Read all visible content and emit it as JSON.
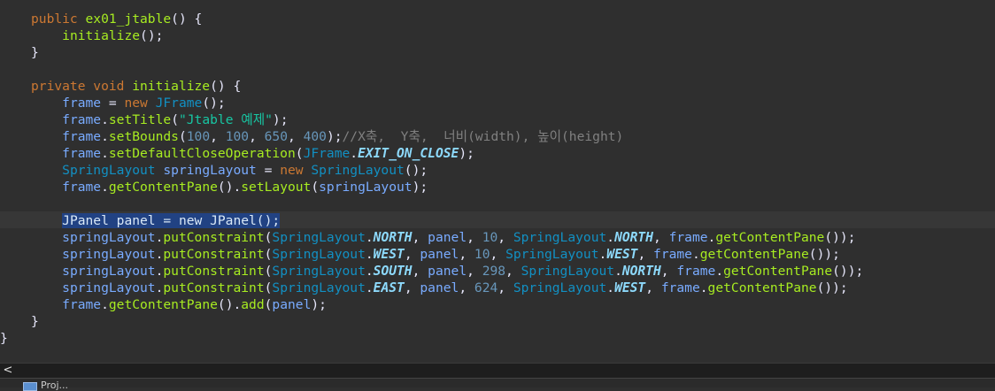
{
  "editor": {
    "lines": [
      [
        [
          "kw",
          "public "
        ],
        [
          "fn",
          "ex01_jtable"
        ],
        [
          "plain",
          "() {"
        ]
      ],
      [
        [
          "plain",
          "    "
        ],
        [
          "fn",
          "initialize"
        ],
        [
          "plain",
          "();"
        ]
      ],
      [
        [
          "plain",
          "}"
        ]
      ],
      [],
      [
        [
          "kw",
          "private void "
        ],
        [
          "fn",
          "initialize"
        ],
        [
          "plain",
          "() {"
        ]
      ],
      [
        [
          "plain",
          "    "
        ],
        [
          "var",
          "frame"
        ],
        [
          "plain",
          " = "
        ],
        [
          "kw",
          "new "
        ],
        [
          "cls",
          "JFrame"
        ],
        [
          "plain",
          "();"
        ]
      ],
      [
        [
          "plain",
          "    "
        ],
        [
          "var",
          "frame"
        ],
        [
          "plain",
          "."
        ],
        [
          "fn",
          "setTitle"
        ],
        [
          "plain",
          "("
        ],
        [
          "str",
          "\"Jtable 예제\""
        ],
        [
          "plain",
          ");"
        ]
      ],
      [
        [
          "plain",
          "    "
        ],
        [
          "var",
          "frame"
        ],
        [
          "plain",
          "."
        ],
        [
          "fn",
          "setBounds"
        ],
        [
          "plain",
          "("
        ],
        [
          "num",
          "100"
        ],
        [
          "plain",
          ", "
        ],
        [
          "num",
          "100"
        ],
        [
          "plain",
          ", "
        ],
        [
          "num",
          "650"
        ],
        [
          "plain",
          ", "
        ],
        [
          "num",
          "400"
        ],
        [
          "plain",
          ");"
        ],
        [
          "cmt",
          "//X축,  Y축,  너비(width), 높이(height)"
        ]
      ],
      [
        [
          "plain",
          "    "
        ],
        [
          "var",
          "frame"
        ],
        [
          "plain",
          "."
        ],
        [
          "fn",
          "setDefaultCloseOperation"
        ],
        [
          "plain",
          "("
        ],
        [
          "cls",
          "JFrame"
        ],
        [
          "plain",
          "."
        ],
        [
          "cst",
          "EXIT_ON_CLOSE"
        ],
        [
          "plain",
          ");"
        ]
      ],
      [
        [
          "plain",
          "    "
        ],
        [
          "cls",
          "SpringLayout "
        ],
        [
          "var",
          "springLayout"
        ],
        [
          "plain",
          " = "
        ],
        [
          "kw",
          "new "
        ],
        [
          "cls",
          "SpringLayout"
        ],
        [
          "plain",
          "();"
        ]
      ],
      [
        [
          "plain",
          "    "
        ],
        [
          "var",
          "frame"
        ],
        [
          "plain",
          "."
        ],
        [
          "fn",
          "getContentPane"
        ],
        [
          "plain",
          "()."
        ],
        [
          "fn",
          "setLayout"
        ],
        [
          "plain",
          "("
        ],
        [
          "var",
          "springLayout"
        ],
        [
          "plain",
          ");"
        ]
      ],
      [],
      [
        [
          "plain",
          "    "
        ],
        [
          "sel",
          "JPanel panel = new JPanel();"
        ]
      ],
      [
        [
          "plain",
          "    "
        ],
        [
          "var",
          "springLayout"
        ],
        [
          "plain",
          "."
        ],
        [
          "fn",
          "putConstraint"
        ],
        [
          "plain",
          "("
        ],
        [
          "cls",
          "SpringLayout"
        ],
        [
          "plain",
          "."
        ],
        [
          "cst",
          "NORTH"
        ],
        [
          "plain",
          ", "
        ],
        [
          "var",
          "panel"
        ],
        [
          "plain",
          ", "
        ],
        [
          "num",
          "10"
        ],
        [
          "plain",
          ", "
        ],
        [
          "cls",
          "SpringLayout"
        ],
        [
          "plain",
          "."
        ],
        [
          "cst",
          "NORTH"
        ],
        [
          "plain",
          ", "
        ],
        [
          "var",
          "frame"
        ],
        [
          "plain",
          "."
        ],
        [
          "fn",
          "getContentPane"
        ],
        [
          "plain",
          "());"
        ]
      ],
      [
        [
          "plain",
          "    "
        ],
        [
          "var",
          "springLayout"
        ],
        [
          "plain",
          "."
        ],
        [
          "fn",
          "putConstraint"
        ],
        [
          "plain",
          "("
        ],
        [
          "cls",
          "SpringLayout"
        ],
        [
          "plain",
          "."
        ],
        [
          "cst",
          "WEST"
        ],
        [
          "plain",
          ", "
        ],
        [
          "var",
          "panel"
        ],
        [
          "plain",
          ", "
        ],
        [
          "num",
          "10"
        ],
        [
          "plain",
          ", "
        ],
        [
          "cls",
          "SpringLayout"
        ],
        [
          "plain",
          "."
        ],
        [
          "cst",
          "WEST"
        ],
        [
          "plain",
          ", "
        ],
        [
          "var",
          "frame"
        ],
        [
          "plain",
          "."
        ],
        [
          "fn",
          "getContentPane"
        ],
        [
          "plain",
          "());"
        ]
      ],
      [
        [
          "plain",
          "    "
        ],
        [
          "var",
          "springLayout"
        ],
        [
          "plain",
          "."
        ],
        [
          "fn",
          "putConstraint"
        ],
        [
          "plain",
          "("
        ],
        [
          "cls",
          "SpringLayout"
        ],
        [
          "plain",
          "."
        ],
        [
          "cst",
          "SOUTH"
        ],
        [
          "plain",
          ", "
        ],
        [
          "var",
          "panel"
        ],
        [
          "plain",
          ", "
        ],
        [
          "num",
          "298"
        ],
        [
          "plain",
          ", "
        ],
        [
          "cls",
          "SpringLayout"
        ],
        [
          "plain",
          "."
        ],
        [
          "cst",
          "NORTH"
        ],
        [
          "plain",
          ", "
        ],
        [
          "var",
          "frame"
        ],
        [
          "plain",
          "."
        ],
        [
          "fn",
          "getContentPane"
        ],
        [
          "plain",
          "());"
        ]
      ],
      [
        [
          "plain",
          "    "
        ],
        [
          "var",
          "springLayout"
        ],
        [
          "plain",
          "."
        ],
        [
          "fn",
          "putConstraint"
        ],
        [
          "plain",
          "("
        ],
        [
          "cls",
          "SpringLayout"
        ],
        [
          "plain",
          "."
        ],
        [
          "cst",
          "EAST"
        ],
        [
          "plain",
          ", "
        ],
        [
          "var",
          "panel"
        ],
        [
          "plain",
          ", "
        ],
        [
          "num",
          "624"
        ],
        [
          "plain",
          ", "
        ],
        [
          "cls",
          "SpringLayout"
        ],
        [
          "plain",
          "."
        ],
        [
          "cst",
          "WEST"
        ],
        [
          "plain",
          ", "
        ],
        [
          "var",
          "frame"
        ],
        [
          "plain",
          "."
        ],
        [
          "fn",
          "getContentPane"
        ],
        [
          "plain",
          "());"
        ]
      ],
      [
        [
          "plain",
          "    "
        ],
        [
          "var",
          "frame"
        ],
        [
          "plain",
          "."
        ],
        [
          "fn",
          "getContentPane"
        ],
        [
          "plain",
          "()."
        ],
        [
          "fn",
          "add"
        ],
        [
          "plain",
          "("
        ],
        [
          "var",
          "panel"
        ],
        [
          "plain",
          ");"
        ]
      ],
      [
        [
          "plain",
          "}"
        ]
      ],
      [
        [
          "plain",
          "}"
        ]
      ]
    ],
    "highlighted_line_index": 12
  },
  "scrollbar": {
    "left_arrow": "<"
  },
  "bottom_panel": {
    "label": "Proj...",
    "icon": "project-icon"
  }
}
